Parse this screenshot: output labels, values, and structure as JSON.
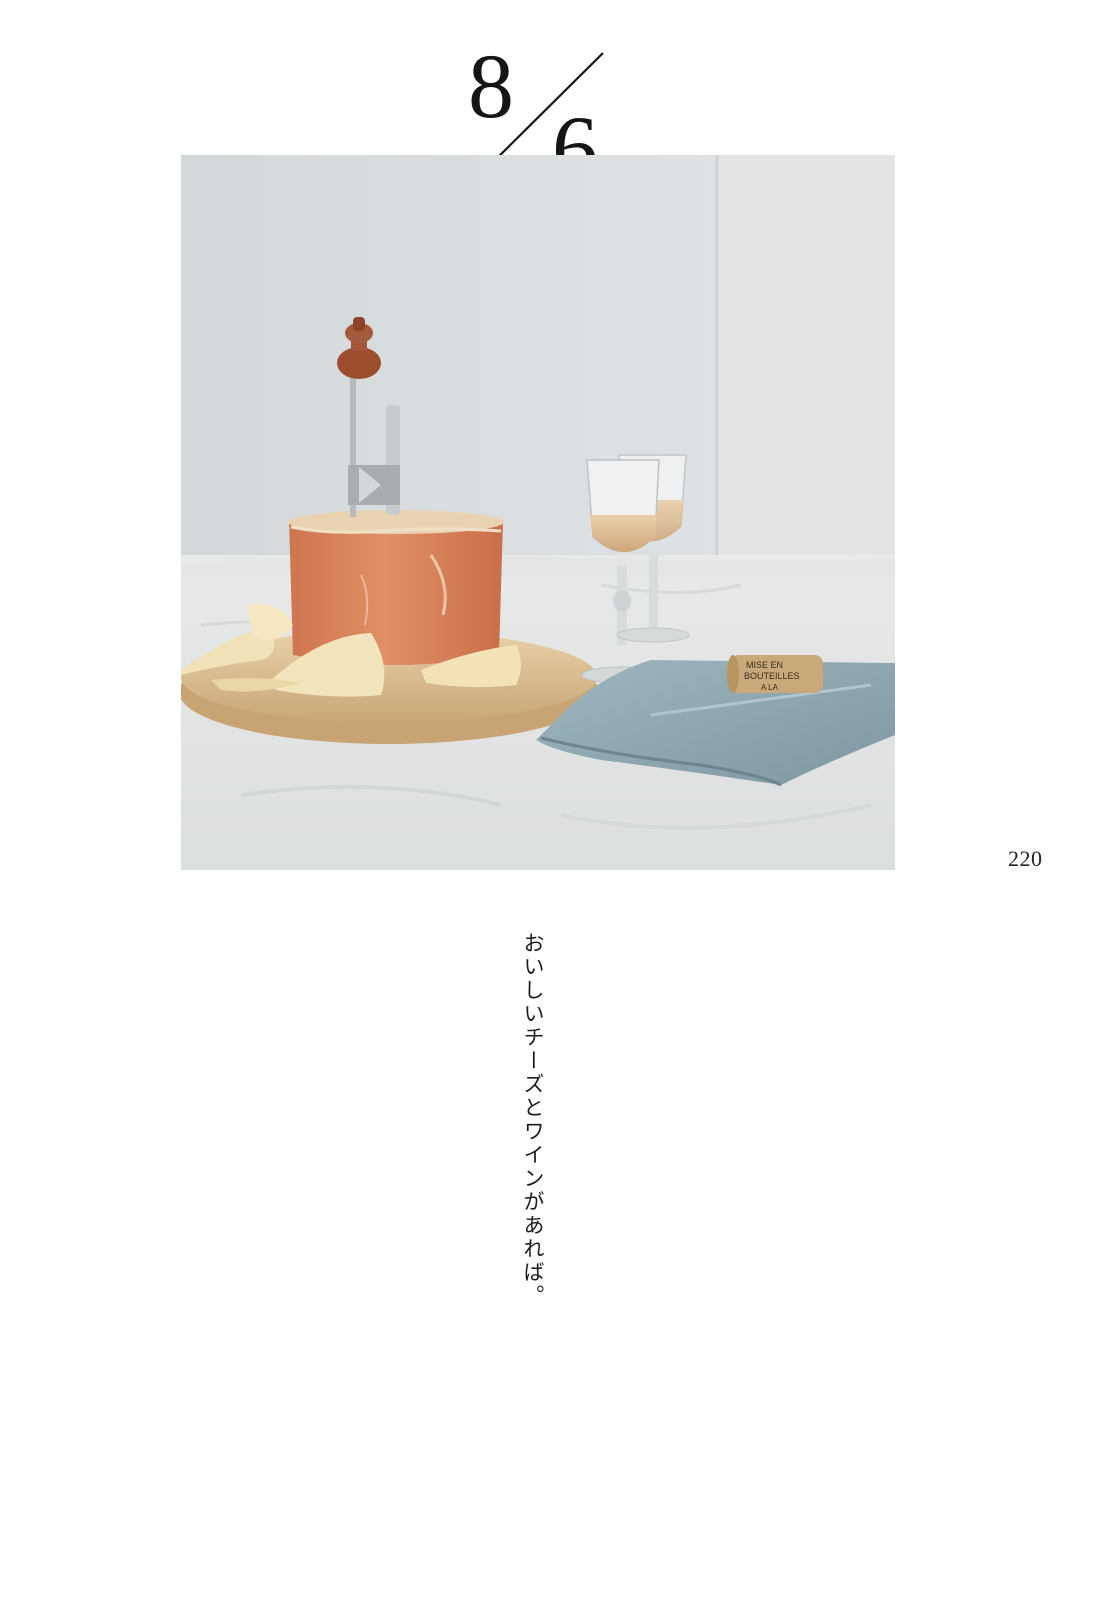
{
  "date": {
    "month": "8",
    "day": "6"
  },
  "page_number": "220",
  "caption": "おいしいチーズとワインがあれば。",
  "photo": {
    "cork_text_line1": "MISE EN",
    "cork_text_line2": "BOUTEILLES",
    "cork_text_line3": "A LA"
  },
  "colors": {
    "background": "#ffffff",
    "wall": "#d9dde0",
    "tablecloth": "#e6e8e6",
    "cheese": "#d8805a",
    "board": "#e0c49a",
    "napkin": "#8fa8b2",
    "wine": "#e2c7a0"
  }
}
